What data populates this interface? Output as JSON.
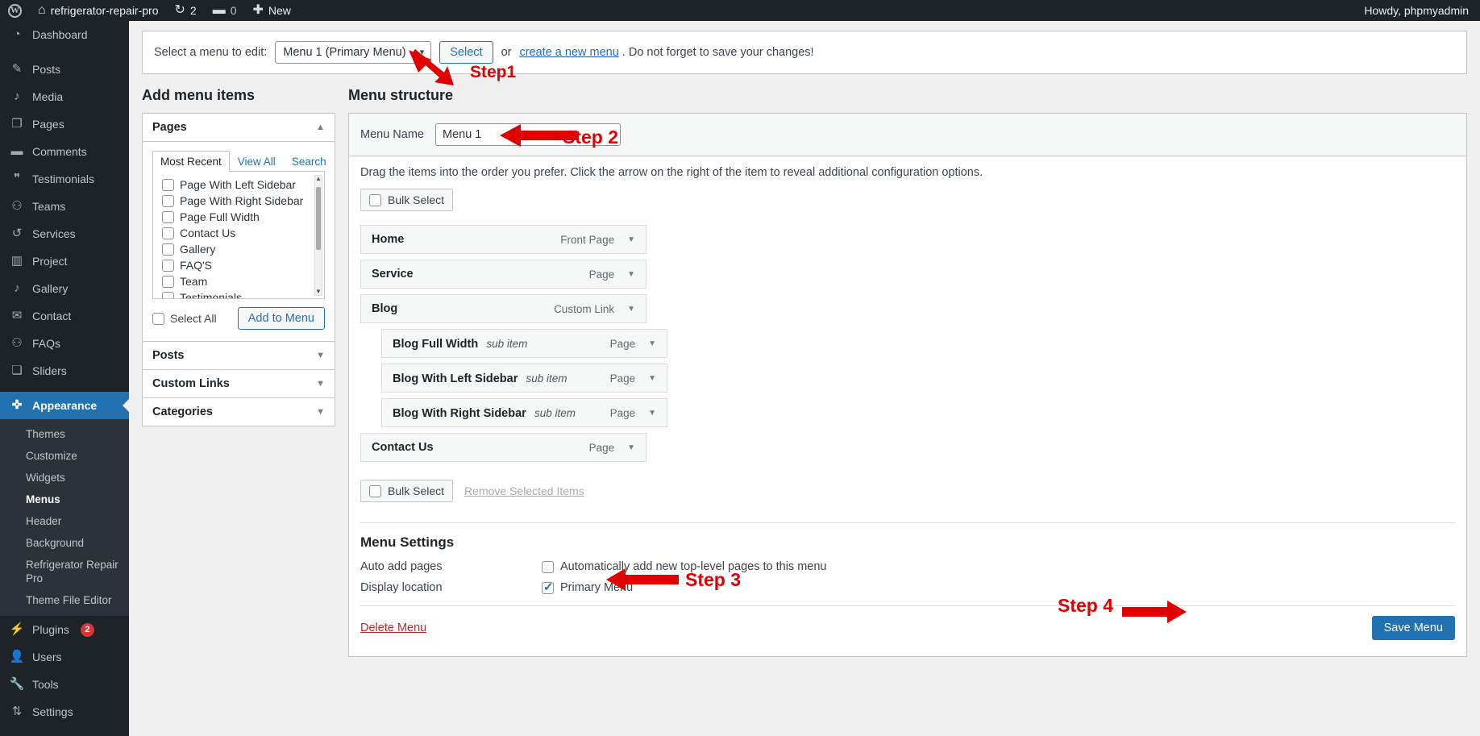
{
  "adminbar": {
    "logo_icon": "wordpress-logo-icon",
    "site_icon": "home-icon",
    "site_name": "refrigerator-repair-pro",
    "updates_icon": "updates-icon",
    "updates_count": "2",
    "comments_icon": "comment-bubble-icon",
    "comments_count": "0",
    "new_icon": "plus-icon",
    "new_label": "New",
    "howdy": "Howdy, phpmyadmin"
  },
  "sidebar": {
    "items": [
      {
        "label": "Dashboard",
        "icon": "dashboard-icon",
        "glyph": "◕"
      },
      {
        "label": "Posts",
        "icon": "pin-icon",
        "glyph": "📌"
      },
      {
        "label": "Media",
        "icon": "media-icon",
        "glyph": "♫"
      },
      {
        "label": "Pages",
        "icon": "pages-icon",
        "glyph": "❐"
      },
      {
        "label": "Comments",
        "icon": "comment-icon",
        "glyph": "🗨"
      },
      {
        "label": "Testimonials",
        "icon": "testimonials-icon",
        "glyph": "❝"
      },
      {
        "label": "Teams",
        "icon": "teams-icon",
        "glyph": "👥"
      },
      {
        "label": "Services",
        "icon": "services-icon",
        "glyph": "↺"
      },
      {
        "label": "Project",
        "icon": "project-icon",
        "glyph": "▥"
      },
      {
        "label": "Gallery",
        "icon": "gallery-icon",
        "glyph": "♫"
      },
      {
        "label": "Contact",
        "icon": "envelope-icon",
        "glyph": "✉"
      },
      {
        "label": "FAQs",
        "icon": "faq-icon",
        "glyph": "💬"
      },
      {
        "label": "Sliders",
        "icon": "sliders-icon",
        "glyph": "❏"
      }
    ],
    "appearance": {
      "label": "Appearance",
      "icon": "appearance-brush-icon",
      "glyph": "🖌"
    },
    "appearance_sub": [
      {
        "label": "Themes",
        "active": false
      },
      {
        "label": "Customize",
        "active": false
      },
      {
        "label": "Widgets",
        "active": false
      },
      {
        "label": "Menus",
        "active": true
      },
      {
        "label": "Header",
        "active": false
      },
      {
        "label": "Background",
        "active": false
      },
      {
        "label": "Refrigerator Repair Pro",
        "active": false
      },
      {
        "label": "Theme File Editor",
        "active": false
      }
    ],
    "bottom_items": [
      {
        "label": "Plugins",
        "icon": "plug-icon",
        "glyph": "🔌",
        "badge": "2"
      },
      {
        "label": "Users",
        "icon": "user-icon",
        "glyph": "👤",
        "badge": ""
      },
      {
        "label": "Tools",
        "icon": "wrench-icon",
        "glyph": "🔧",
        "badge": ""
      },
      {
        "label": "Settings",
        "icon": "settings-sliders-icon",
        "glyph": "⇅",
        "badge": ""
      }
    ]
  },
  "menu_select": {
    "label": "Select a menu to edit:",
    "selected": "Menu 1 (Primary Menu)",
    "options": [
      "Menu 1 (Primary Menu)"
    ],
    "select_button": "Select",
    "or_text": "or",
    "create_link": "create a new menu",
    "trailing_text": ". Do not forget to save your changes!",
    "caret_icon": "chevron-down-icon"
  },
  "add_menu_items": {
    "title": "Add menu items",
    "panels": [
      {
        "title": "Pages",
        "expanded": true,
        "toggle_icon": "chevron-up-icon",
        "tabs": [
          {
            "label": "Most Recent",
            "active": true
          },
          {
            "label": "View All",
            "active": false
          },
          {
            "label": "Search",
            "active": false
          }
        ],
        "pages": [
          "Page With Left Sidebar",
          "Page With Right Sidebar",
          "Page Full Width",
          "Contact Us",
          "Gallery",
          "FAQ'S",
          "Team",
          "Testimonials"
        ],
        "select_all_label": "Select All",
        "add_button": "Add to Menu"
      },
      {
        "title": "Posts",
        "expanded": false,
        "toggle_icon": "chevron-down-icon"
      },
      {
        "title": "Custom Links",
        "expanded": false,
        "toggle_icon": "chevron-down-icon"
      },
      {
        "title": "Categories",
        "expanded": false,
        "toggle_icon": "chevron-down-icon"
      }
    ]
  },
  "menu_structure": {
    "title": "Menu structure",
    "menu_name_label": "Menu Name",
    "menu_name_value": "Menu 1",
    "hint": "Drag the items into the order you prefer. Click the arrow on the right of the item to reveal additional configuration options.",
    "bulk_select_top": "Bulk Select",
    "bulk_select_bottom": "Bulk Select",
    "remove_selected": "Remove Selected Items",
    "items": [
      {
        "title": "Home",
        "sub_label": "",
        "type": "Front Page",
        "depth": 0,
        "caret_icon": "chevron-down-icon"
      },
      {
        "title": "Service",
        "sub_label": "",
        "type": "Page",
        "depth": 0,
        "caret_icon": "chevron-down-icon"
      },
      {
        "title": "Blog",
        "sub_label": "",
        "type": "Custom Link",
        "depth": 0,
        "caret_icon": "chevron-down-icon"
      },
      {
        "title": "Blog Full Width",
        "sub_label": "sub item",
        "type": "Page",
        "depth": 1,
        "caret_icon": "chevron-down-icon"
      },
      {
        "title": "Blog With Left Sidebar",
        "sub_label": "sub item",
        "type": "Page",
        "depth": 1,
        "caret_icon": "chevron-down-icon"
      },
      {
        "title": "Blog With Right Sidebar",
        "sub_label": "sub item",
        "type": "Page",
        "depth": 1,
        "caret_icon": "chevron-down-icon"
      },
      {
        "title": "Contact Us",
        "sub_label": "",
        "type": "Page",
        "depth": 0,
        "caret_icon": "chevron-down-icon"
      }
    ]
  },
  "menu_settings": {
    "title": "Menu Settings",
    "auto_add_label": "Auto add pages",
    "auto_add_checkbox_label": "Automatically add new top-level pages to this menu",
    "auto_add_checked": false,
    "display_location_label": "Display location",
    "display_location_checkbox_label": "Primary Menu",
    "display_location_checked": true,
    "delete_menu": "Delete Menu",
    "save_button": "Save Menu"
  },
  "annotations": [
    {
      "label": "Step1",
      "arrow_icon": "red-arrow-up-left-icon"
    },
    {
      "label": "Step 2",
      "arrow_icon": "red-arrow-left-icon"
    },
    {
      "label": "Step 3",
      "arrow_icon": "red-arrow-left-icon"
    },
    {
      "label": "Step 4",
      "arrow_icon": "red-arrow-right-icon"
    }
  ],
  "colors": {
    "admin_dark": "#1d2327",
    "accent_blue": "#2271b1",
    "annotation_red": "#e00000",
    "badge_red": "#d63638"
  }
}
